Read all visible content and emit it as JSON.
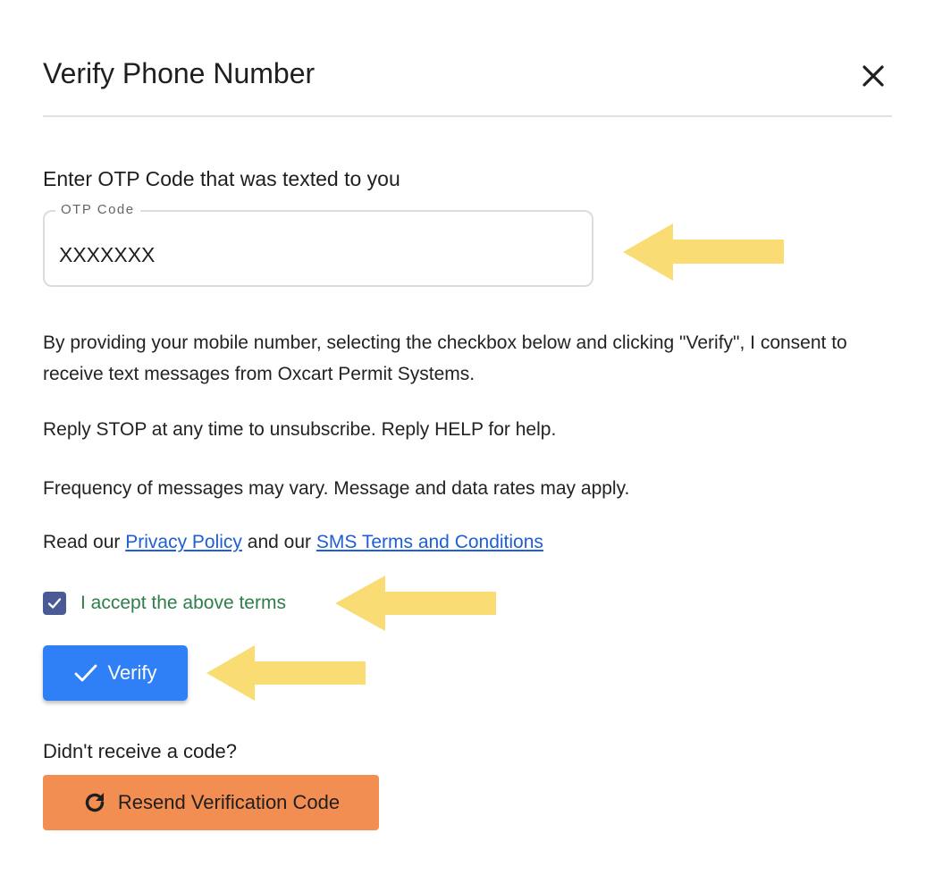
{
  "dialog": {
    "title": "Verify Phone Number",
    "close_icon": "close-icon"
  },
  "otp": {
    "section_label": "Enter OTP Code that was texted to you",
    "field_label": "OTP Code",
    "value": "XXXXXXX"
  },
  "consent": {
    "text": "By providing your mobile number, selecting the checkbox below and clicking \"Verify\", I consent to receive text messages from Oxcart Permit Systems.",
    "stop_help": "Reply STOP at any time to unsubscribe. Reply HELP for help.",
    "frequency": "Frequency of messages may vary. Message and data rates may apply.",
    "read_prefix": "Read our",
    "privacy_link": "Privacy Policy",
    "and_our": "and our",
    "sms_terms_link": "SMS Terms and Conditions"
  },
  "terms_checkbox": {
    "label": "I accept the above terms",
    "checked": true
  },
  "verify_button": {
    "label": "Verify",
    "icon": "check-icon"
  },
  "resend": {
    "prompt": "Didn't receive a code?",
    "button_label": "Resend Verification Code",
    "icon": "refresh-icon"
  },
  "colors": {
    "verify_button": "#2f80f7",
    "resend_button": "#f28e52",
    "checkbox": "#4a5a94",
    "checkbox_label": "#2e7d4a",
    "link": "#1f5fd1",
    "annotation_arrow": "#f9dc74"
  },
  "annotations": {
    "arrow_icon": "arrow-left-icon",
    "count": 3
  }
}
